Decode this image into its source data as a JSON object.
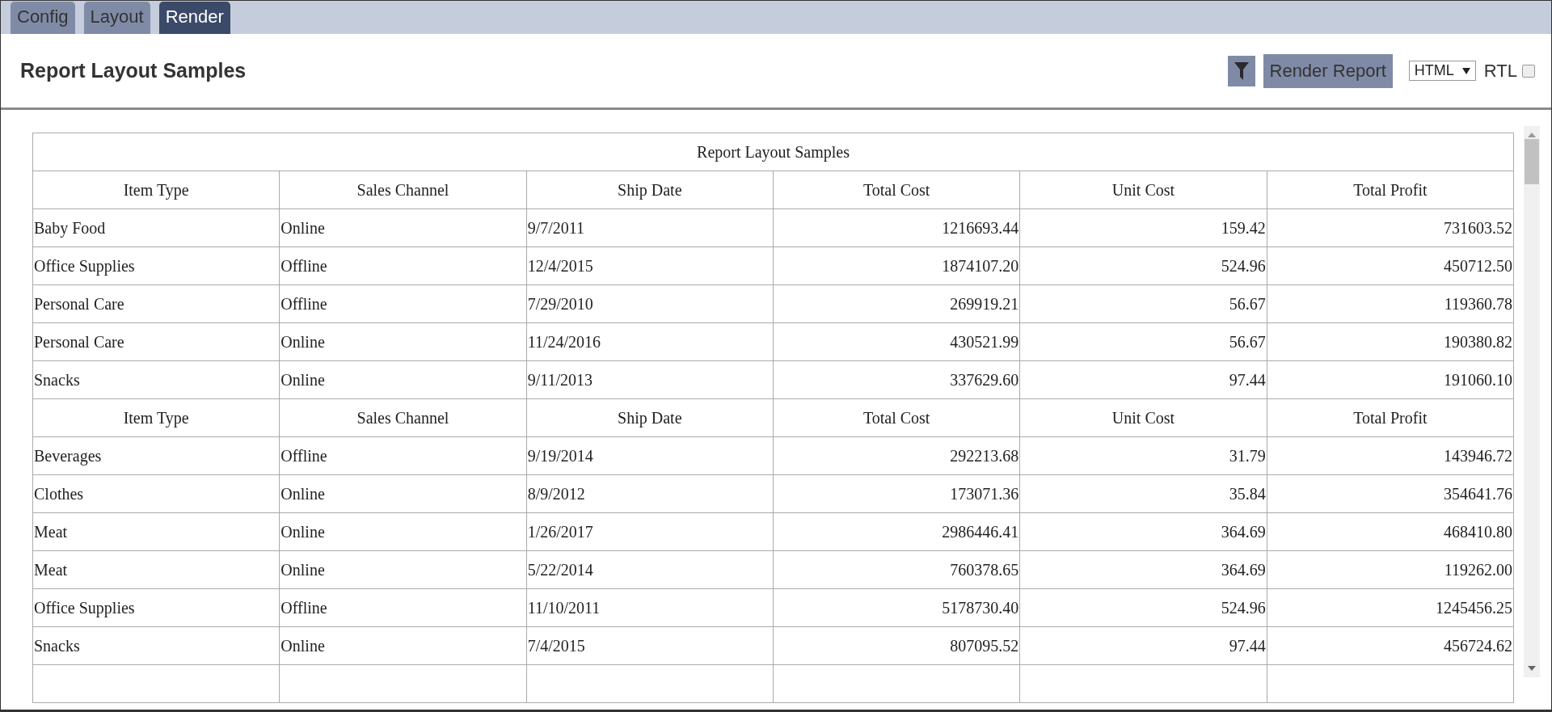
{
  "tabs": [
    {
      "label": "Config",
      "selected": false
    },
    {
      "label": "Layout",
      "selected": false
    },
    {
      "label": "Render",
      "selected": true
    }
  ],
  "header": {
    "title": "Report Layout Samples",
    "render_button": "Render Report",
    "format": "HTML",
    "rtl": {
      "label": "RTL",
      "checked": false
    }
  },
  "report": {
    "title": "Report Layout Samples",
    "groups": [
      {
        "columns": [
          {
            "label": "Item Type",
            "kind": "text"
          },
          {
            "label": "Sales Channel",
            "kind": "text"
          },
          {
            "label": "Ship Date",
            "kind": "text"
          },
          {
            "label": "Total Cost",
            "kind": "number"
          },
          {
            "label": "Unit Cost",
            "kind": "number"
          },
          {
            "label": "Total Profit",
            "kind": "number"
          }
        ],
        "rows": [
          [
            "Baby Food",
            "Online",
            "9/7/2011",
            "1216693.44",
            "159.42",
            "731603.52"
          ],
          [
            "Office Supplies",
            "Offline",
            "12/4/2015",
            "1874107.20",
            "524.96",
            "450712.50"
          ],
          [
            "Personal Care",
            "Offline",
            "7/29/2010",
            "269919.21",
            "56.67",
            "119360.78"
          ],
          [
            "Personal Care",
            "Online",
            "11/24/2016",
            "430521.99",
            "56.67",
            "190380.82"
          ],
          [
            "Snacks",
            "Online",
            "9/11/2013",
            "337629.60",
            "97.44",
            "191060.10"
          ]
        ]
      },
      {
        "columns": [
          {
            "label": "Item Type",
            "kind": "text"
          },
          {
            "label": "Sales Channel",
            "kind": "text"
          },
          {
            "label": "Ship Date",
            "kind": "text"
          },
          {
            "label": "Total Cost",
            "kind": "number"
          },
          {
            "label": "Unit Cost",
            "kind": "number"
          },
          {
            "label": "Total Profit",
            "kind": "number"
          }
        ],
        "rows": [
          [
            "Beverages",
            "Offline",
            "9/19/2014",
            "292213.68",
            "31.79",
            "143946.72"
          ],
          [
            "Clothes",
            "Online",
            "8/9/2012",
            "173071.36",
            "35.84",
            "354641.76"
          ],
          [
            "Meat",
            "Online",
            "1/26/2017",
            "2986446.41",
            "364.69",
            "468410.80"
          ],
          [
            "Meat",
            "Online",
            "5/22/2014",
            "760378.65",
            "364.69",
            "119262.00"
          ],
          [
            "Office Supplies",
            "Offline",
            "11/10/2011",
            "5178730.40",
            "524.96",
            "1245456.25"
          ],
          [
            "Snacks",
            "Online",
            "7/4/2015",
            "807095.52",
            "97.44",
            "456724.62"
          ]
        ]
      }
    ]
  }
}
